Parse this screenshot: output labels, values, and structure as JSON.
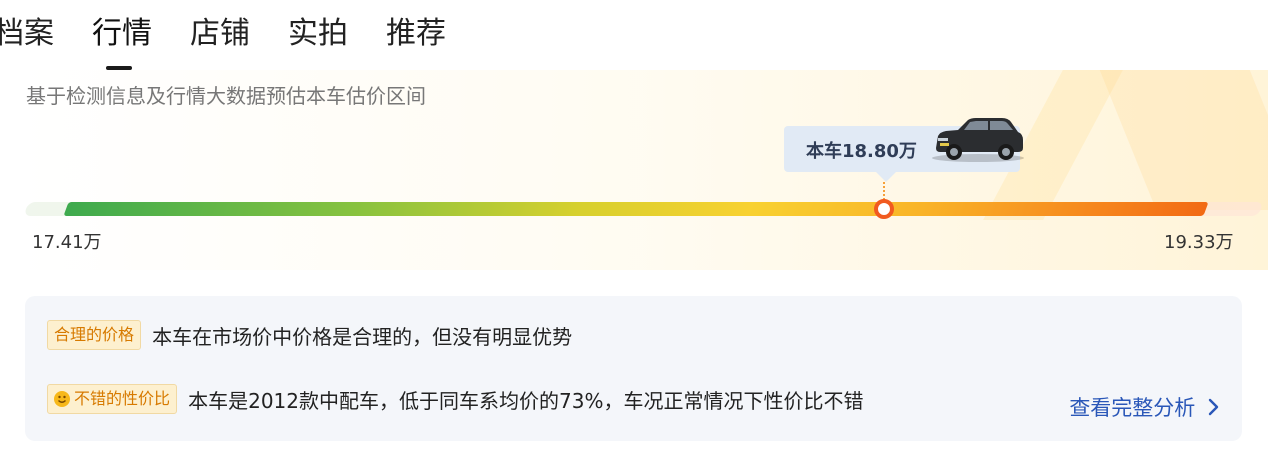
{
  "tabs": [
    {
      "label": "档案"
    },
    {
      "label": "行情",
      "active": true
    },
    {
      "label": "店铺"
    },
    {
      "label": "实拍"
    },
    {
      "label": "推荐"
    }
  ],
  "estimate": {
    "subtitle": "基于检测信息及行情大数据预估本车估价区间",
    "this_car_label": "本车18.80万",
    "min_label": "17.41万",
    "max_label": "19.33万",
    "marker_position_fraction": 0.727,
    "colors": {
      "bar_start": "#3eaa4e",
      "bar_mid": "#f8d131",
      "bar_end": "#f26a14",
      "marker": "#f15a1f"
    },
    "car_icon": "suv-car-icon"
  },
  "analysis": {
    "rows": [
      {
        "tag": "合理的价格",
        "text": "本车在市场价中价格是合理的，但没有明显优势"
      },
      {
        "tag": "不错的性价比",
        "tag_icon": "smile-icon",
        "text": "本车是2012款中配车，低于同车系均价的73%，车况正常情况下性价比不错"
      }
    ],
    "link_label": "查看完整分析",
    "link_color": "#2a57b8"
  }
}
